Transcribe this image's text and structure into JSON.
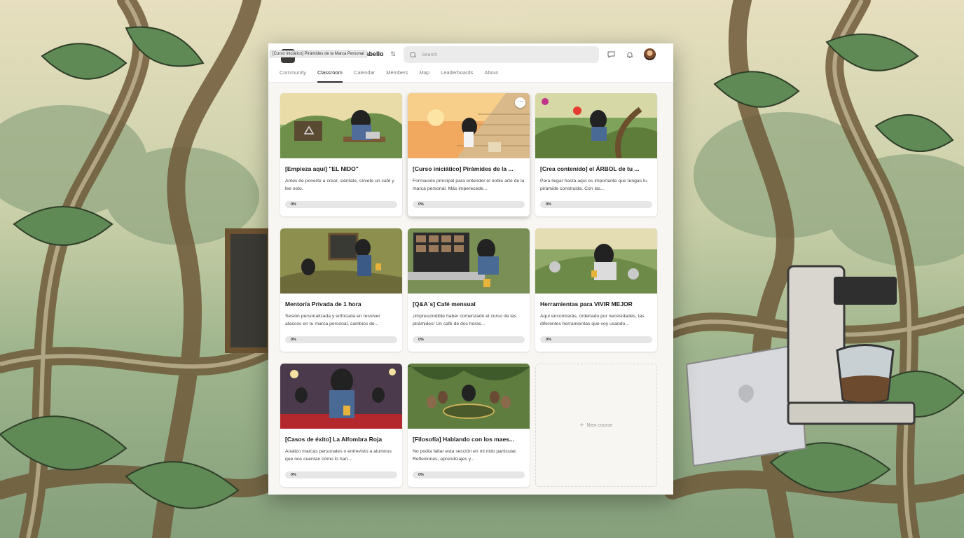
{
  "header": {
    "group_name": "Cabello",
    "tooltip": "[Curso iniciático] Pirámides de la Marca Personal",
    "search_placeholder": "Search",
    "group_switch_icon": "chevron-updown-icon",
    "chat_icon": "chat-icon",
    "bell_icon": "bell-icon"
  },
  "tabs": [
    {
      "label": "Community"
    },
    {
      "label": "Classroom",
      "active": true
    },
    {
      "label": "Calendar"
    },
    {
      "label": "Members"
    },
    {
      "label": "Map"
    },
    {
      "label": "Leaderboards"
    },
    {
      "label": "About"
    }
  ],
  "courses": [
    {
      "title": "[Empieza aquí] \"EL NIDO\"",
      "desc": "Antes de ponerte a crear, siéntate, sírvete un café y lee esto.",
      "progress": "0%"
    },
    {
      "title": "[Curso iniciático] Pirámides de la ...",
      "desc": "Formación principal para entender el noble arte de la marca personal. Más imperecede...",
      "progress": "0%",
      "more": "···"
    },
    {
      "title": "[Crea contenido] el ÁRBOL de tu ...",
      "desc": "Para llegar hasta aquí es importante que tengas tu pirámide construida. Con las...",
      "progress": "0%"
    },
    {
      "title": "Mentoría Privada de 1 hora",
      "desc": "Sesión personalizada y enfocada en resolver atascos en tu marca personal, cambios de...",
      "progress": "0%"
    },
    {
      "title": "[Q&A´s] Café mensual",
      "desc": "¡Imprescindible haber comenzado el curso de las pirámides! Un café de dos horas...",
      "progress": "0%"
    },
    {
      "title": "Herramientas para VIVIR MEJOR",
      "desc": "Aquí encontrarás, ordenado por necesidades, las diferentes herramientas que voy usando...",
      "progress": "0%"
    },
    {
      "title": "[Casos de éxito] La Alfombra Roja",
      "desc": "Analizo marcas personales o entrevisto a alumnos que nos cuentan cómo lo han...",
      "progress": "0%"
    },
    {
      "title": "[Filosofía] Hablando con los maes...",
      "desc": "No podía faltar esta sección en mi nido particular. Reflexiones, aprendizajes y...",
      "progress": "0%"
    }
  ],
  "new_course": {
    "label": "New course",
    "icon": "plus-icon"
  },
  "colors": {
    "accent": "#2a2a2a",
    "progress_track": "#e6e6e6"
  }
}
